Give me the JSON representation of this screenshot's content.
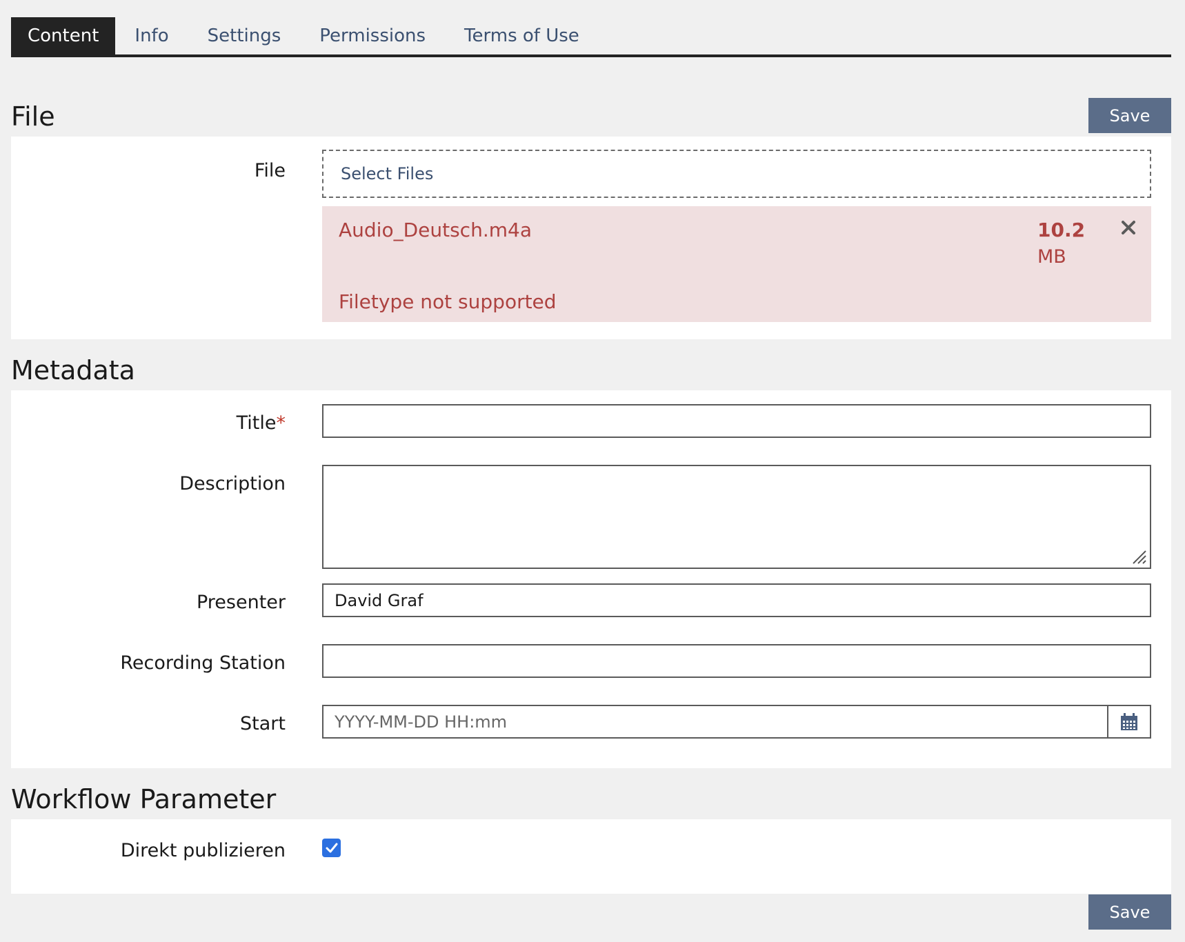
{
  "tabs": [
    {
      "label": "Content",
      "active": true
    },
    {
      "label": "Info"
    },
    {
      "label": "Settings"
    },
    {
      "label": "Permissions"
    },
    {
      "label": "Terms of Use"
    }
  ],
  "file_section": {
    "heading": "File",
    "save_label": "Save",
    "field_label": "File",
    "dropzone_label": "Select Files",
    "error_item": {
      "name": "Audio_Deutsch.m4a",
      "size_value": "10.2",
      "size_unit": "MB",
      "message": "Filetype not supported",
      "remove_icon": "close-icon"
    }
  },
  "metadata_section": {
    "heading": "Metadata",
    "title_label": "Title",
    "required_mark": "*",
    "title_value": "",
    "description_label": "Description",
    "description_value": "",
    "presenter_label": "Presenter",
    "presenter_value": "David Graf",
    "recording_station_label": "Recording Station",
    "recording_station_value": "",
    "start_label": "Start",
    "start_placeholder": "YYYY-MM-DD HH:mm",
    "start_icon": "calendar-icon"
  },
  "workflow_section": {
    "heading": "Workflow Parameter",
    "publish_label": "Direkt publizieren",
    "publish_checked": true
  },
  "footer": {
    "save_label": "Save"
  },
  "colors": {
    "accent": "#5b6d89",
    "tab_active": "#232323",
    "error_bg": "#f0dfe0",
    "error_text": "#ad4240",
    "checkbox": "#2b6fe0"
  }
}
